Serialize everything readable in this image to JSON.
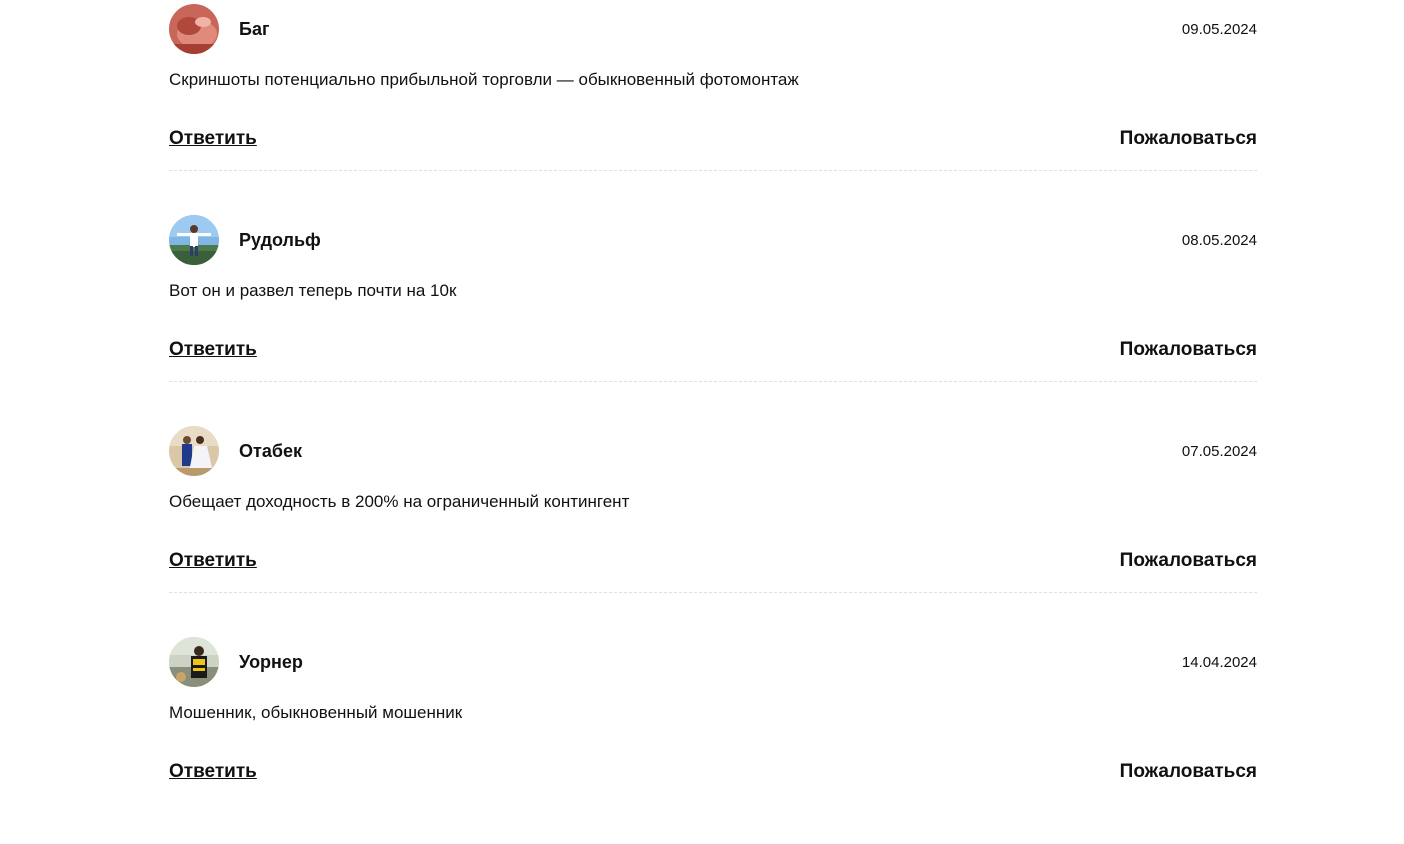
{
  "comments": [
    {
      "author": "Баг",
      "date": "09.05.2024",
      "text": "Скриншоты потенциально прибыльной торговли — обыкновенный фотомонтаж",
      "reply_label": "Ответить",
      "report_label": "Пожаловаться",
      "avatar_icon": "photo-avatar-red-hand"
    },
    {
      "author": "Рудольф",
      "date": "08.05.2024",
      "text": "Вот он и развел теперь почти на 10к",
      "reply_label": "Ответить",
      "report_label": "Пожаловаться",
      "avatar_icon": "photo-avatar-man-sky"
    },
    {
      "author": "Отабек",
      "date": "07.05.2024",
      "text": "Обещает доходность в 200% на ограниченный контингент",
      "reply_label": "Ответить",
      "report_label": "Пожаловаться",
      "avatar_icon": "photo-avatar-wedding-couple"
    },
    {
      "author": "Уорнер",
      "date": "14.04.2024",
      "text": "Мошенник, обыкновенный мошенник",
      "reply_label": "Ответить",
      "report_label": "Пожаловаться",
      "avatar_icon": "photo-avatar-man-yellow-shirt"
    }
  ],
  "colors": {
    "text": "#111111",
    "divider": "#e0e0e0",
    "background": "#ffffff"
  }
}
